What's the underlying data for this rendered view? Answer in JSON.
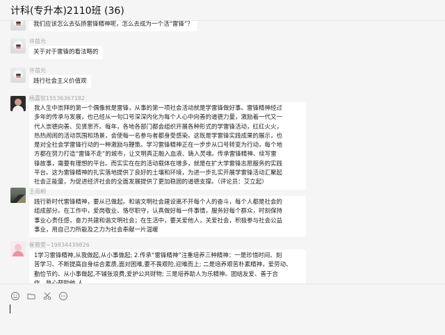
{
  "title": "计科(专升本)2110班 (36)",
  "messages": [
    {
      "sender": "",
      "text": "我们应该怎么去弘扬雷锋精神呢，怎么去成为一个活“雷锋”？",
      "avatar": "dog-icon"
    },
    {
      "sender": "许苗元",
      "text": "关于对于雷锋的看法略的",
      "avatar": "dog-icon"
    },
    {
      "sender": "许苗元",
      "text": "践行社会主义价值观",
      "avatar": "dog-icon"
    },
    {
      "sender": "杨嘉钦15536367182",
      "text": "我人生中崇拜的第一个偶像就是雷锋，从事的第一项社会活动就是学雷锋做好事。雷锋精神经过\n多年的传承与发展，也已经从一句口号深深内化为每个人心中向善的道德力量，激励着一代又一\n代人崇德向善、见贤思齐。每年，各地各部门都会组织开展各种形式的学雷锋活动，红红火火，\n热热闹闹的活动氛围和场景，会使每一名参与者都身受感染。这既是学雷锋实践成果的展示，也\n是对全社会学雷锋行动的一种激励与鞭策。学习雷锋精神正在一步步从口号转变为行动，每个地\n方都在努力打造“雷锋不走”的城市，让文明真正融入血液、铸入灵魂。传承雷锋精神、续写雷\n锋故事，需要有理想的平台。而实实在在的活动载体在增多，就是在扩大学雷锋志愿服务的实践\n平台。这为雷锋精神的扎实落地提供了良好的土壤和环境，为进一步扎实开展学雷锋活动汇聚起\n社会正能量，为促进经济社会的全面发展提供了更加稳固的道德支撑。（评论员：艾立起）",
      "avatar": "person-icon"
    },
    {
      "sender": "王雨桐",
      "text": "践行新时代雷锋精神，要从已做起。和谐文明社会建设离不开每个人的奋斗，每个人都是社会的\n组成部分。在工作中，爱岗敬业、恪尽职守，认真做好每一件事情，服务好每个群众，时刻保持\n事业心责任感，奋力共建和谐文明社会；在生活中，要关爱他人，关爱社会，积极参与社会公益\n事业，用自己力所能及之力为社会奉献一片温暖",
      "avatar": "landscape-icon"
    },
    {
      "sender": "崔雅雯~19834439826",
      "text": "1学习雷锋精神,从我做起,从小事做起; 2.传承“雷锋精神”注重培养三种精神：一是珍惜时间、刻\n苦学习、不断提高自身综合素质,面对困难,要不畏艰险,迎难而上; 二是培养艰苦朴素精神，爱劳动、\n勤俭节约、从小事做起,不铺张浪费,爱护公共财物; 三是培养助人为乐精神。团结友爱、善于合\n作、热心帮助他 人。",
      "avatar": "pink-person-icon"
    }
  ],
  "input": {
    "value": ""
  },
  "toolbar": {
    "icons": [
      "emoji-icon",
      "folder-icon",
      "scissors-icon",
      "more-icon"
    ]
  }
}
